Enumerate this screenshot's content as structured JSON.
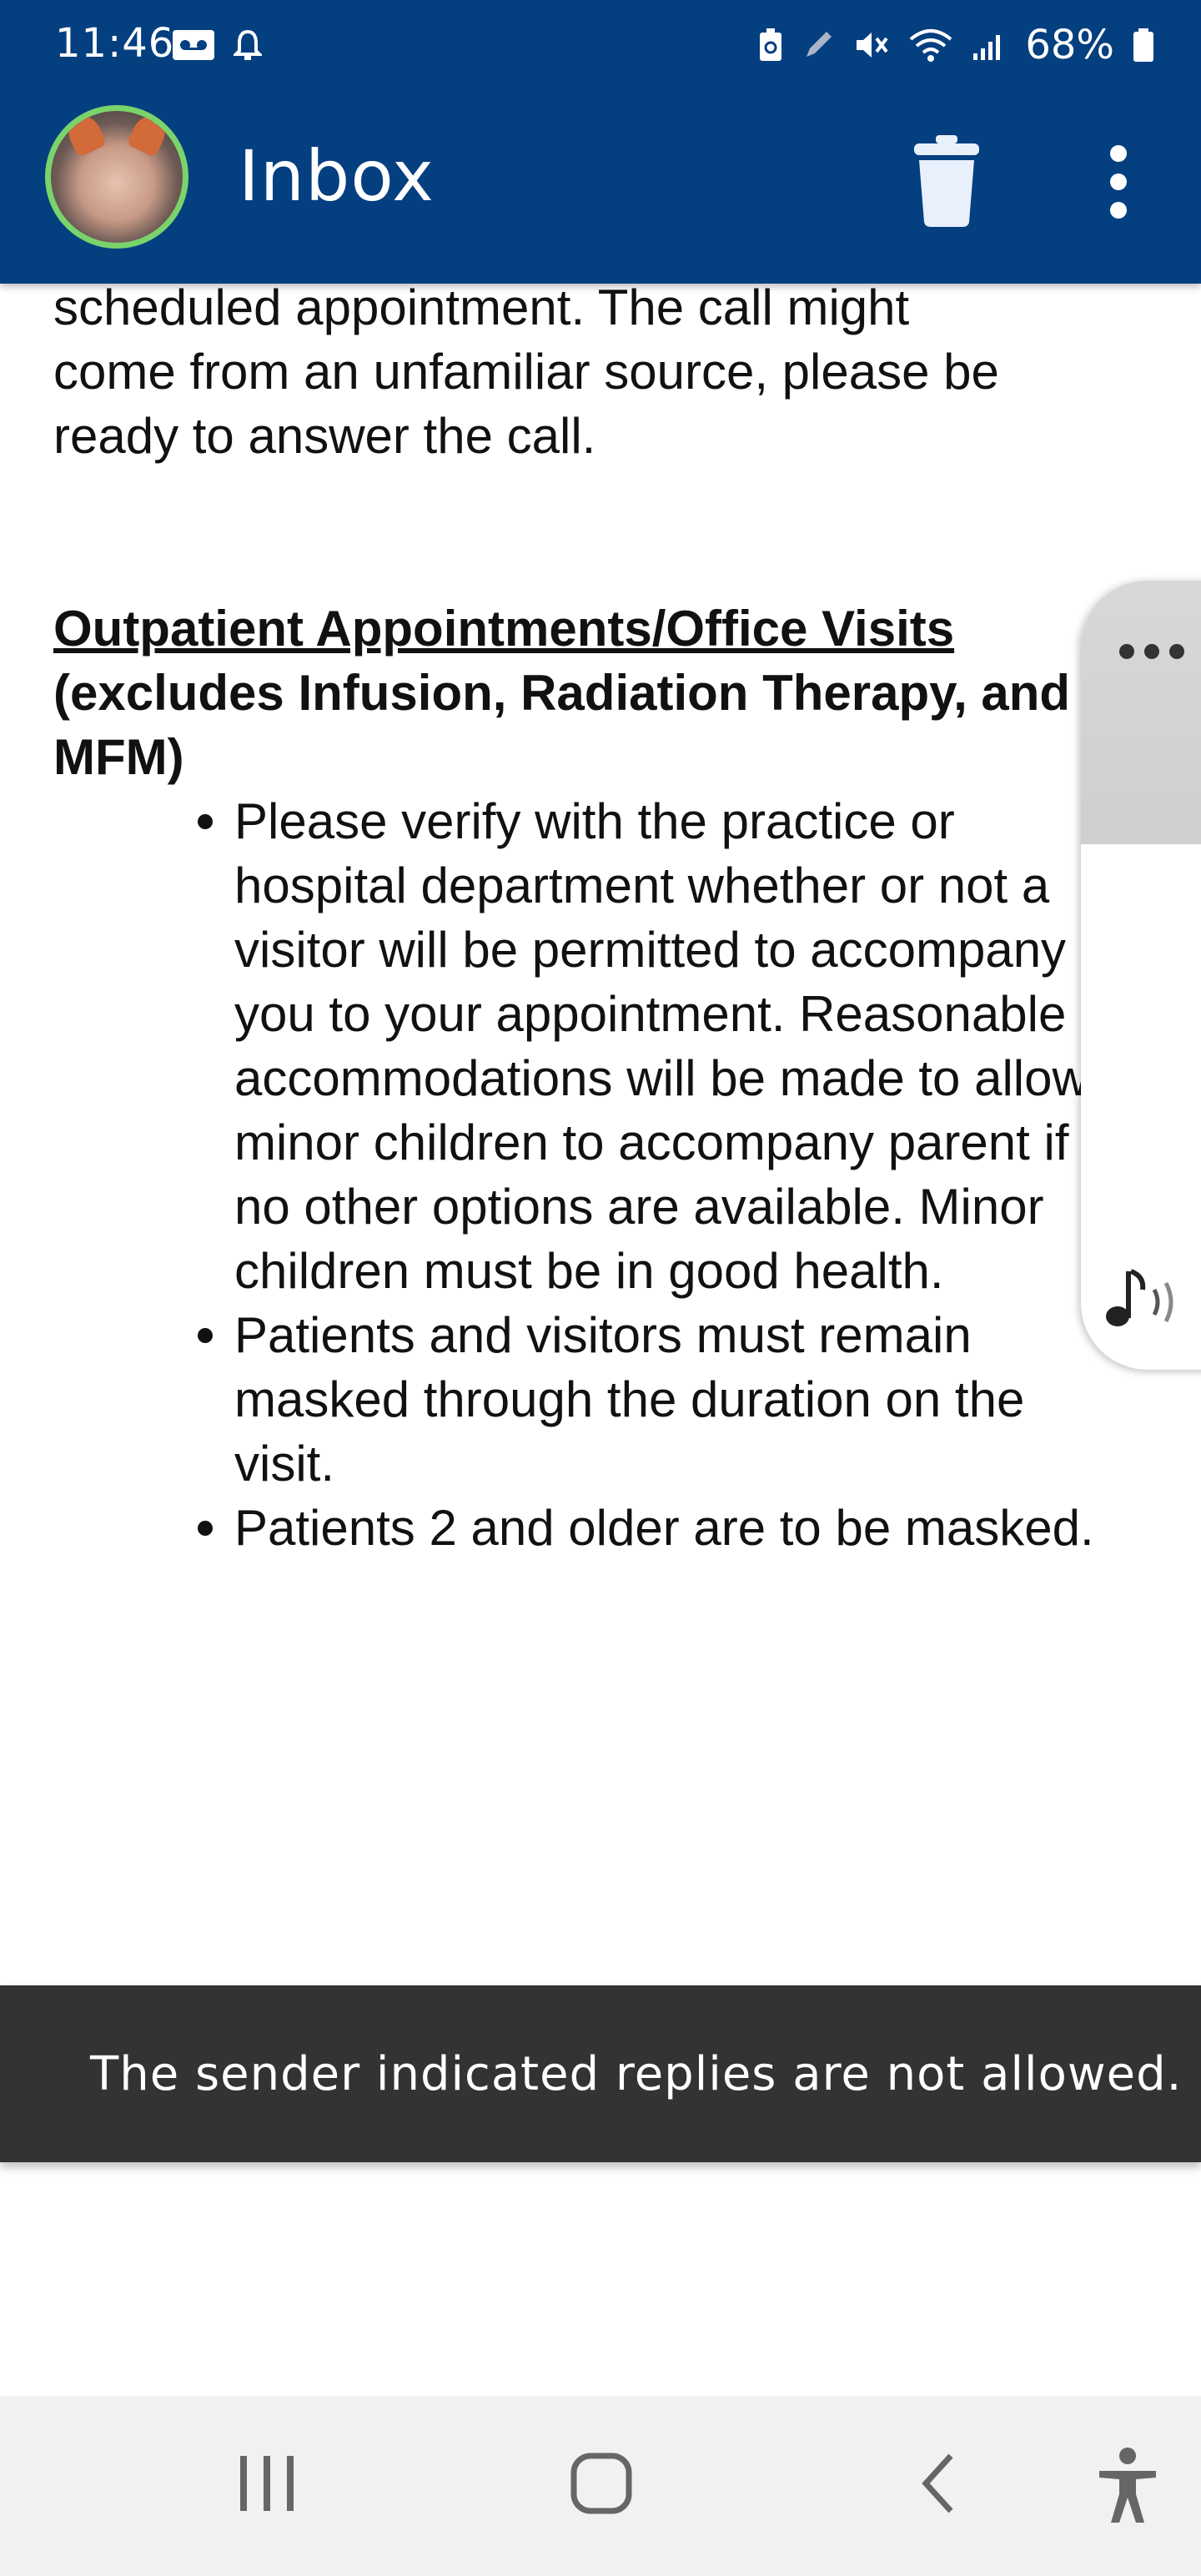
{
  "status_bar": {
    "time": "11:46",
    "battery": "68%",
    "left_icons": [
      "voicemail-icon",
      "bell-icon"
    ],
    "right_icons": [
      "battery-saver-icon",
      "pen-icon",
      "mute-icon",
      "wifi-icon",
      "signal-icon",
      "battery-icon"
    ]
  },
  "app_bar": {
    "title": "Inbox",
    "actions": [
      "trash-icon",
      "more-vert-icon"
    ]
  },
  "message": {
    "intro_lines": [
      "scheduled appointment. The call might",
      "come from an unfamiliar source, please be",
      "ready to answer the call."
    ],
    "section_heading": "Outpatient Appointments/Office Visits ",
    "section_sub": "(excludes Infusion, Radiation Therapy, and MFM)",
    "bullets": [
      "Please verify with the practice or hospital department whether or not a visitor will be permitted to accompany you to your appointment. Reasonable accommodations will be made to allow minor children to accompany parent if no other options are available. Minor children must be in good health.",
      "Patients and visitors must remain masked through the duration on the visit.",
      "Patients 2 and older are to be masked."
    ]
  },
  "snackbar": {
    "text": "The sender indicated replies are not allowed."
  },
  "nav_bar": {
    "buttons": [
      "recents-icon",
      "home-icon",
      "back-icon",
      "accessibility-icon"
    ]
  },
  "colors": {
    "app_bar": "#043f80",
    "snackbar": "#333333",
    "avatar_ring": "#7ad36b"
  }
}
